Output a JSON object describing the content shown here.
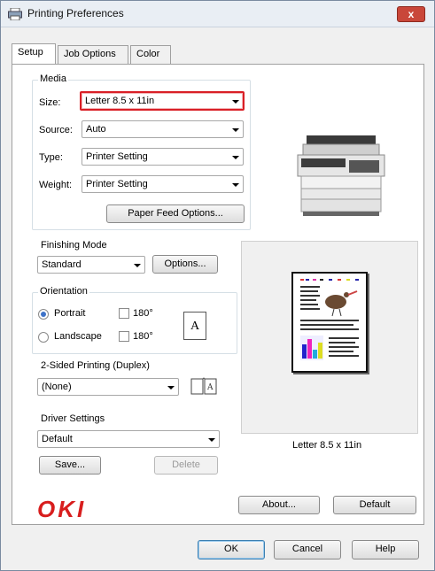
{
  "window": {
    "title": "Printing Preferences",
    "close_label": "x"
  },
  "tabs": [
    {
      "label": "Setup"
    },
    {
      "label": "Job Options"
    },
    {
      "label": "Color"
    }
  ],
  "media": {
    "legend": "Media",
    "size_label": "Size:",
    "size_value": "Letter 8.5 x 11in",
    "source_label": "Source:",
    "source_value": "Auto",
    "type_label": "Type:",
    "type_value": "Printer Setting",
    "weight_label": "Weight:",
    "weight_value": "Printer Setting",
    "paper_feed_button": "Paper Feed Options..."
  },
  "finishing": {
    "legend": "Finishing Mode",
    "value": "Standard",
    "options_button": "Options..."
  },
  "orientation": {
    "legend": "Orientation",
    "portrait_label": "Portrait",
    "landscape_label": "Landscape",
    "rotate_label_1": "180°",
    "rotate_label_2": "180°",
    "icon_letter": "A",
    "selected": "portrait"
  },
  "duplex": {
    "legend": "2-Sided Printing (Duplex)",
    "value": "(None)"
  },
  "driver": {
    "legend": "Driver Settings",
    "value": "Default",
    "save_button": "Save...",
    "delete_button": "Delete"
  },
  "preview": {
    "caption": "Letter 8.5 x 11in"
  },
  "brand": {
    "logo_text": "OKI",
    "logo_color": "#d81e1e"
  },
  "actions": {
    "about_button": "About...",
    "default_button": "Default",
    "ok_button": "OK",
    "cancel_button": "Cancel",
    "help_button": "Help"
  },
  "colors": {
    "highlight": "#d91f26",
    "selection_dot": "#3f73c8"
  }
}
